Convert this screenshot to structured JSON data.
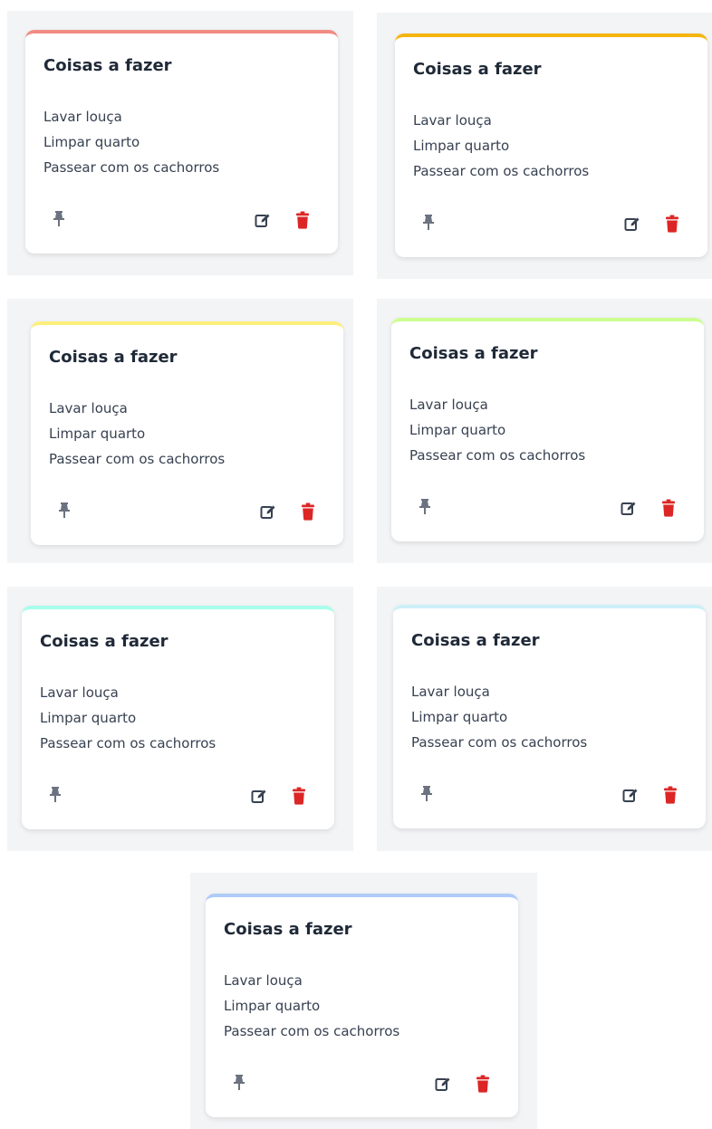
{
  "notes": [
    {
      "title": "Coisas a fazer",
      "items": [
        "Lavar louça",
        "Limpar quarto",
        "Passear com os cachorros"
      ],
      "accent": "#f28b82"
    },
    {
      "title": "Coisas a fazer",
      "items": [
        "Lavar louça",
        "Limpar quarto",
        "Passear com os cachorros"
      ],
      "accent": "#f6b40e"
    },
    {
      "title": "Coisas a fazer",
      "items": [
        "Lavar louça",
        "Limpar quarto",
        "Passear com os cachorros"
      ],
      "accent": "#fdf07a"
    },
    {
      "title": "Coisas a fazer",
      "items": [
        "Lavar louça",
        "Limpar quarto",
        "Passear com os cachorros"
      ],
      "accent": "#ccff90"
    },
    {
      "title": "Coisas a fazer",
      "items": [
        "Lavar louça",
        "Limpar quarto",
        "Passear com os cachorros"
      ],
      "accent": "#a7ffeb"
    },
    {
      "title": "Coisas a fazer",
      "items": [
        "Lavar louça",
        "Limpar quarto",
        "Passear com os cachorros"
      ],
      "accent": "#cbf0f8"
    },
    {
      "title": "Coisas a fazer",
      "items": [
        "Lavar louça",
        "Limpar quarto",
        "Passear com os cachorros"
      ],
      "accent": "#aecbfa"
    }
  ],
  "icons": {
    "pin": "pin-icon",
    "edit": "edit-icon",
    "delete": "trash-icon"
  },
  "colors": {
    "icon_gray": "#6b7280",
    "edit_dark": "#374151",
    "delete_red": "#dc2626"
  }
}
